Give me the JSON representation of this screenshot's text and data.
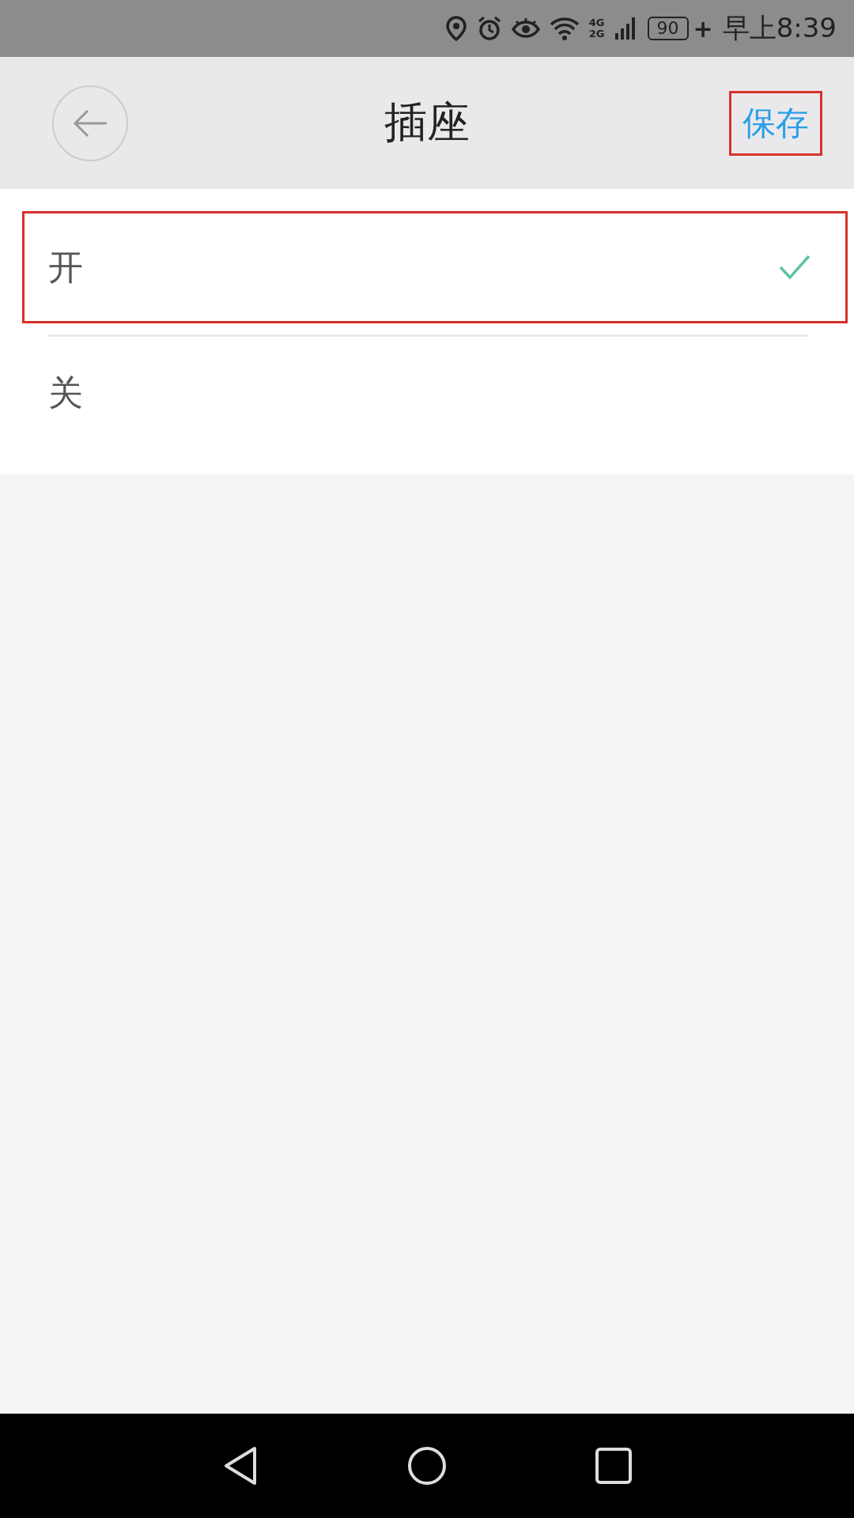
{
  "status_bar": {
    "network_top": "4G",
    "network_bottom": "2G",
    "battery": "90",
    "charging": "+",
    "time": "早上8:39"
  },
  "header": {
    "title": "插座",
    "save": "保存",
    "save_highlighted": true
  },
  "options": [
    {
      "label": "开",
      "selected": true,
      "highlighted": true
    },
    {
      "label": "关",
      "selected": false,
      "highlighted": false
    }
  ]
}
